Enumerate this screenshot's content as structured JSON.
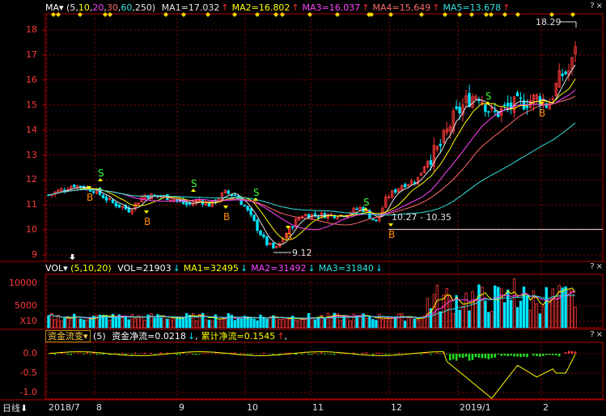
{
  "main_panel": {
    "indicator_name": "MA",
    "params": [
      "5",
      "10",
      "20",
      "30",
      "60",
      "250"
    ],
    "ma_values": [
      {
        "label": "MA1=17.032",
        "color": "#e6e6e6",
        "arrow": "up"
      },
      {
        "label": "MA2=16.802",
        "color": "#ffff00",
        "arrow": "up"
      },
      {
        "label": "MA3=16.037",
        "color": "#ff44ff",
        "arrow": "up"
      },
      {
        "label": "MA4=15.649",
        "color": "#ff6a6a",
        "arrow": "up"
      },
      {
        "label": "MA5=13.678",
        "color": "#33e0e0",
        "arrow": "up"
      }
    ],
    "y_ticks": [
      "18",
      "17",
      "16",
      "15",
      "14",
      "13",
      "12",
      "11",
      "10",
      "9"
    ],
    "annotations": {
      "high": "18.29",
      "low": "9.12",
      "mid_low": "10.27",
      "mid_high": "10.35"
    },
    "signal_buy": "B",
    "signal_sell": "S"
  },
  "vol_panel": {
    "indicator_name": "VOL",
    "params": "(5,10,20)",
    "values": [
      {
        "label": "VOL=21903",
        "color": "#ffffff",
        "arrow": "down"
      },
      {
        "label": "MA1=32495",
        "color": "#ffff00",
        "arrow": "down"
      },
      {
        "label": "MA2=31492",
        "color": "#ff44ff",
        "arrow": "down"
      },
      {
        "label": "MA3=31840",
        "color": "#33e0e0",
        "arrow": "down"
      }
    ],
    "y_ticks": [
      "10000",
      "5000",
      "X10"
    ]
  },
  "flow_panel": {
    "indicator_name": "资金流变",
    "params": "(5)",
    "values": [
      {
        "label": "资金净流=0.0218",
        "color": "#ffffff",
        "arrow": "down"
      },
      {
        "label": "累计净流=0.1545",
        "color": "#ffff00",
        "arrow": "up"
      }
    ],
    "y_ticks": [
      "0.0",
      "-0.5",
      "-1.0"
    ]
  },
  "corner_icons": "?×",
  "x_axis": {
    "period": "日线",
    "labels": [
      "2018/7",
      "8",
      "9",
      "10",
      "11",
      "12",
      "2019/1",
      "2"
    ]
  },
  "colors": {
    "up": "#ff3a3a",
    "down": "#00e5ff",
    "grid": "#8a0000",
    "axis": "#b00000"
  }
}
